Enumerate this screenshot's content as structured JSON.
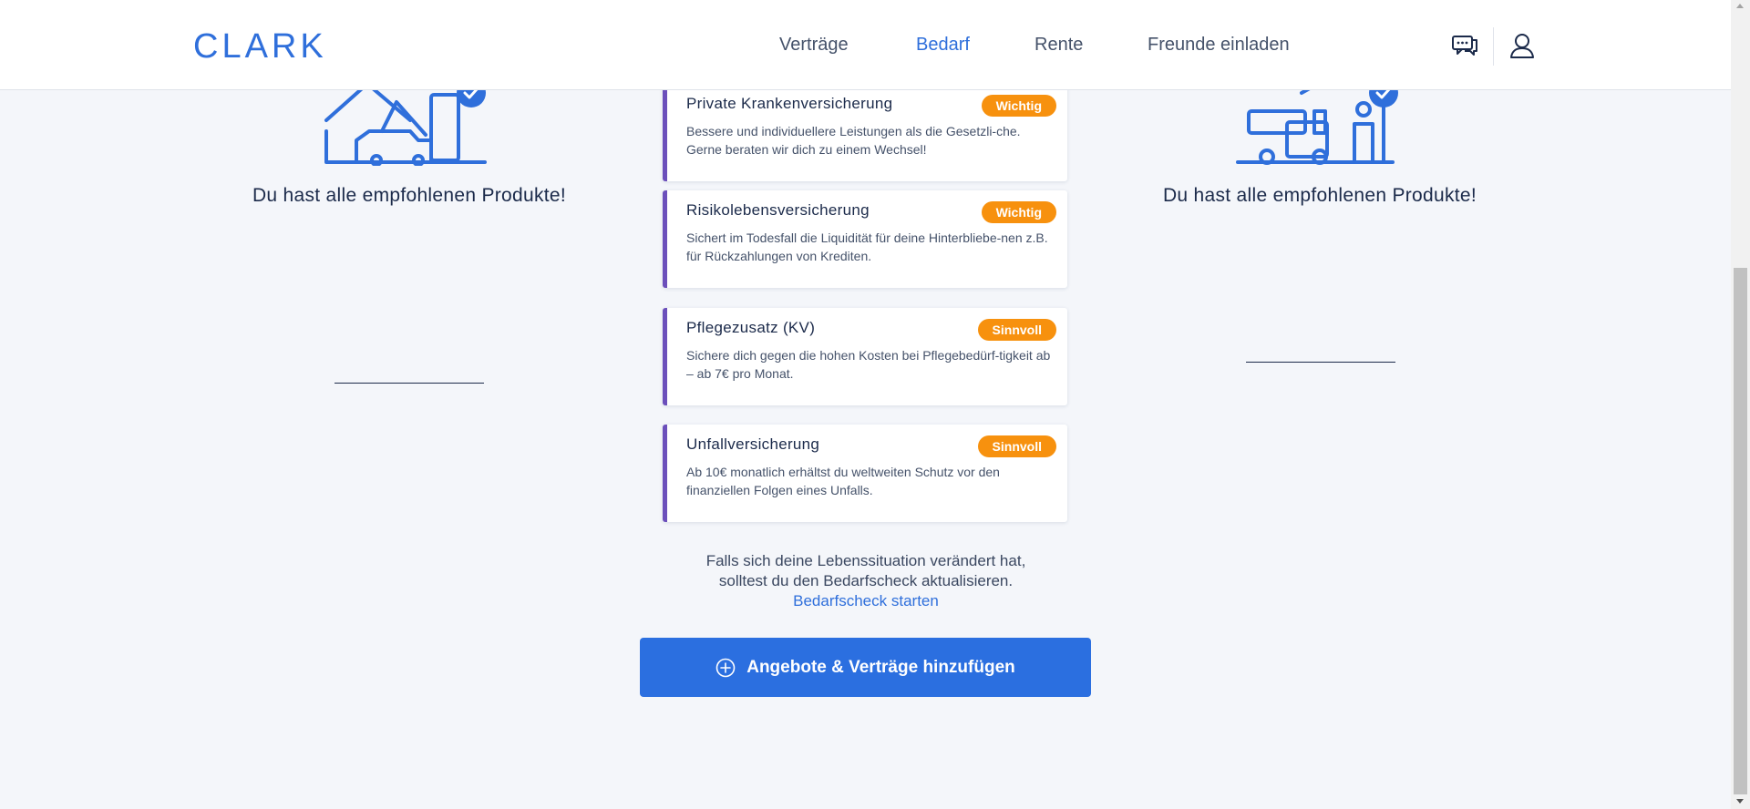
{
  "header": {
    "logo": "CLARK",
    "nav": [
      {
        "label": "Verträge",
        "active": false
      },
      {
        "label": "Bedarf",
        "active": true
      },
      {
        "label": "Rente",
        "active": false
      },
      {
        "label": "Freunde einladen",
        "active": false
      }
    ],
    "icons": [
      "chat-icon",
      "user-icon"
    ]
  },
  "left_column": {
    "illustration": "house-car-check-icon",
    "title": "Du hast alle empfohlenen Produkte!"
  },
  "right_column": {
    "illustration": "camper-person-check-icon",
    "title": "Du hast alle empfohlenen Produkte!"
  },
  "cards": [
    {
      "title": "Private Krankenversicherung",
      "badge": "Wichtig",
      "description": "Bessere und individuellere Leistungen als die Gesetzli-che. Gerne beraten wir dich zu einem Wechsel!"
    },
    {
      "title": "Risikolebensversicherung",
      "badge": "Wichtig",
      "description": "Sichert im Todesfall die Liquidität für deine Hinterbliebe-nen z.B. für Rückzahlungen von Krediten."
    },
    {
      "title": "Pflegezusatz (KV)",
      "badge": "Sinnvoll",
      "description": "Sichere dich gegen die hohen Kosten bei Pflegebedürf-tigkeit ab – ab 7€ pro Monat."
    },
    {
      "title": "Unfallversicherung",
      "badge": "Sinnvoll",
      "description": "Ab 10€ monatlich erhältst du weltweiten Schutz vor den finanziellen Folgen eines Unfalls."
    }
  ],
  "info": {
    "line1": "Falls sich deine Lebenssituation verändert hat,",
    "line2": "solltest du den Bedarfscheck aktualisieren.",
    "link": "Bedarfscheck starten"
  },
  "cta": {
    "label": "Angebote & Verträge hinzufügen",
    "icon": "plus-circle-icon"
  },
  "colors": {
    "brand": "#2f6fdb",
    "badge": "#f7910e",
    "card_accent": "#6b4fbb",
    "background": "#f4f6fa"
  }
}
